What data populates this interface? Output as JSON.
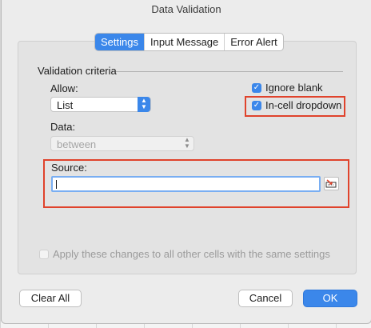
{
  "window": {
    "title": "Data Validation"
  },
  "tabs": [
    {
      "label": "Settings",
      "active": true
    },
    {
      "label": "Input Message",
      "active": false
    },
    {
      "label": "Error Alert",
      "active": false
    }
  ],
  "settings": {
    "section_title": "Validation criteria",
    "allow": {
      "label": "Allow:",
      "value": "List"
    },
    "data": {
      "label": "Data:",
      "value": "between",
      "disabled": true
    },
    "ignore_blank": {
      "label": "Ignore blank",
      "checked": true
    },
    "in_cell_dropdown": {
      "label": "In-cell dropdown",
      "checked": true
    },
    "source": {
      "label": "Source:",
      "value": ""
    },
    "apply_all": {
      "label": "Apply these changes to all other cells with the same settings",
      "checked": false,
      "disabled": true
    }
  },
  "buttons": {
    "clear_all": "Clear All",
    "cancel": "Cancel",
    "ok": "OK"
  },
  "colors": {
    "accent": "#3b87ea",
    "highlight": "#e0432c"
  },
  "icons": {
    "checkmark": "✓",
    "stepper": "stepper-arrows-icon",
    "collapse": "range-collapse-icon"
  }
}
